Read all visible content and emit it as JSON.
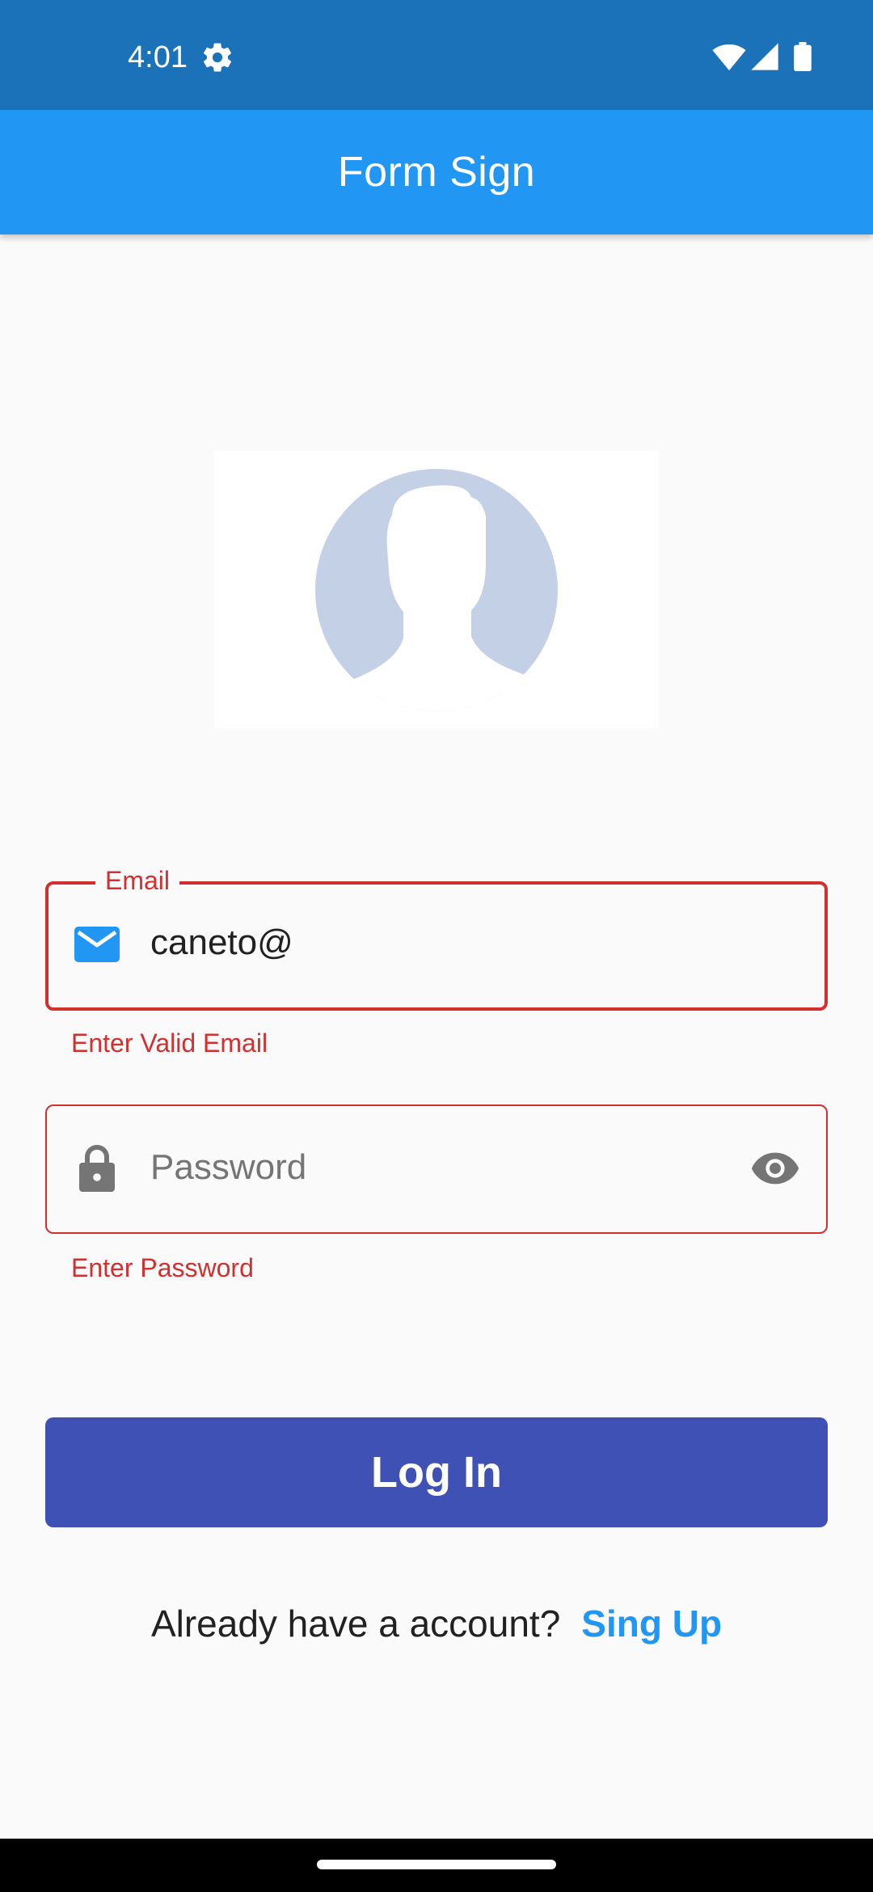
{
  "status_bar": {
    "time": "4:01",
    "icons": [
      "gear-icon",
      "wifi-icon",
      "signal-icon",
      "battery-icon"
    ]
  },
  "app_bar": {
    "title": "Form Sign",
    "color": "#2196f3"
  },
  "avatar": {
    "icon": "person-silhouette-icon"
  },
  "form": {
    "email": {
      "label": "Email",
      "value": "caneto@",
      "error": "Enter Valid Email",
      "icon": "email-icon"
    },
    "password": {
      "placeholder": "Password",
      "error": "Enter Password",
      "icon": "lock-icon",
      "toggle_icon": "eye-icon"
    }
  },
  "login_button": {
    "label": "Log In",
    "color": "#3f51b5"
  },
  "signup": {
    "prompt": "Already have a account?",
    "link": "Sing Up",
    "link_color": "#2196f3"
  },
  "colors": {
    "error": "#d32f2f",
    "status_bar": "#1b72b9",
    "background": "#fafafa"
  }
}
